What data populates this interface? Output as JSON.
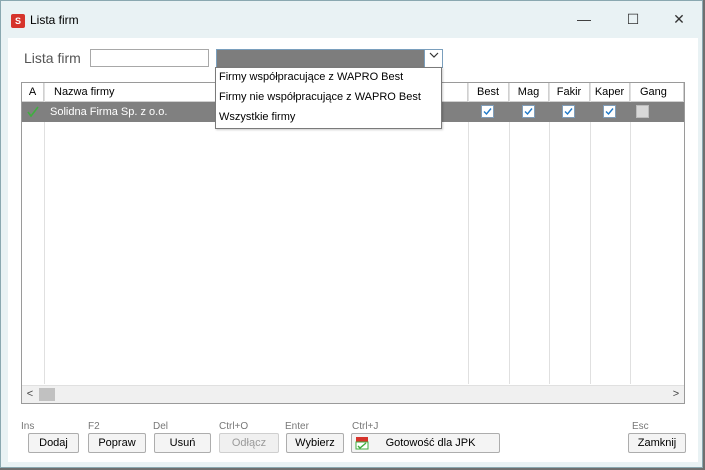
{
  "window": {
    "title": "Lista firm",
    "app_icon": "S",
    "minimize": "—",
    "maximize": "☐",
    "close": "✕"
  },
  "filter": {
    "label": "Lista firm",
    "search_value": "",
    "combo_value": ""
  },
  "grid": {
    "columns": [
      "A",
      "Nazwa firmy",
      "Best",
      "Mag",
      "Fakir",
      "Kaper",
      "Gang"
    ],
    "rows": [
      {
        "active": true,
        "name": "Solidna Firma Sp. z o.o.",
        "best": true,
        "mag": true,
        "fakir": true,
        "kaper": true,
        "gang": false
      }
    ]
  },
  "dropdown": {
    "options": [
      "Firmy współpracujące z WAPRO Best",
      "Firmy nie współpracujące z WAPRO Best",
      "Wszystkie firmy"
    ]
  },
  "toolbar": {
    "add": {
      "hotkey": "Ins",
      "label": "Dodaj"
    },
    "edit": {
      "hotkey": "F2",
      "label": "Popraw"
    },
    "delete": {
      "hotkey": "Del",
      "label": "Usuń"
    },
    "detach": {
      "hotkey": "Ctrl+O",
      "label": "Odłącz"
    },
    "select": {
      "hotkey": "Enter",
      "label": "Wybierz"
    },
    "jpk": {
      "hotkey": "Ctrl+J",
      "label": "Gotowość dla JPK"
    },
    "close": {
      "hotkey": "Esc",
      "label": "Zamknij"
    }
  },
  "colors": {
    "selected_row": "#808080",
    "check": "#1e78c8",
    "accent_red": "#d6342c"
  }
}
